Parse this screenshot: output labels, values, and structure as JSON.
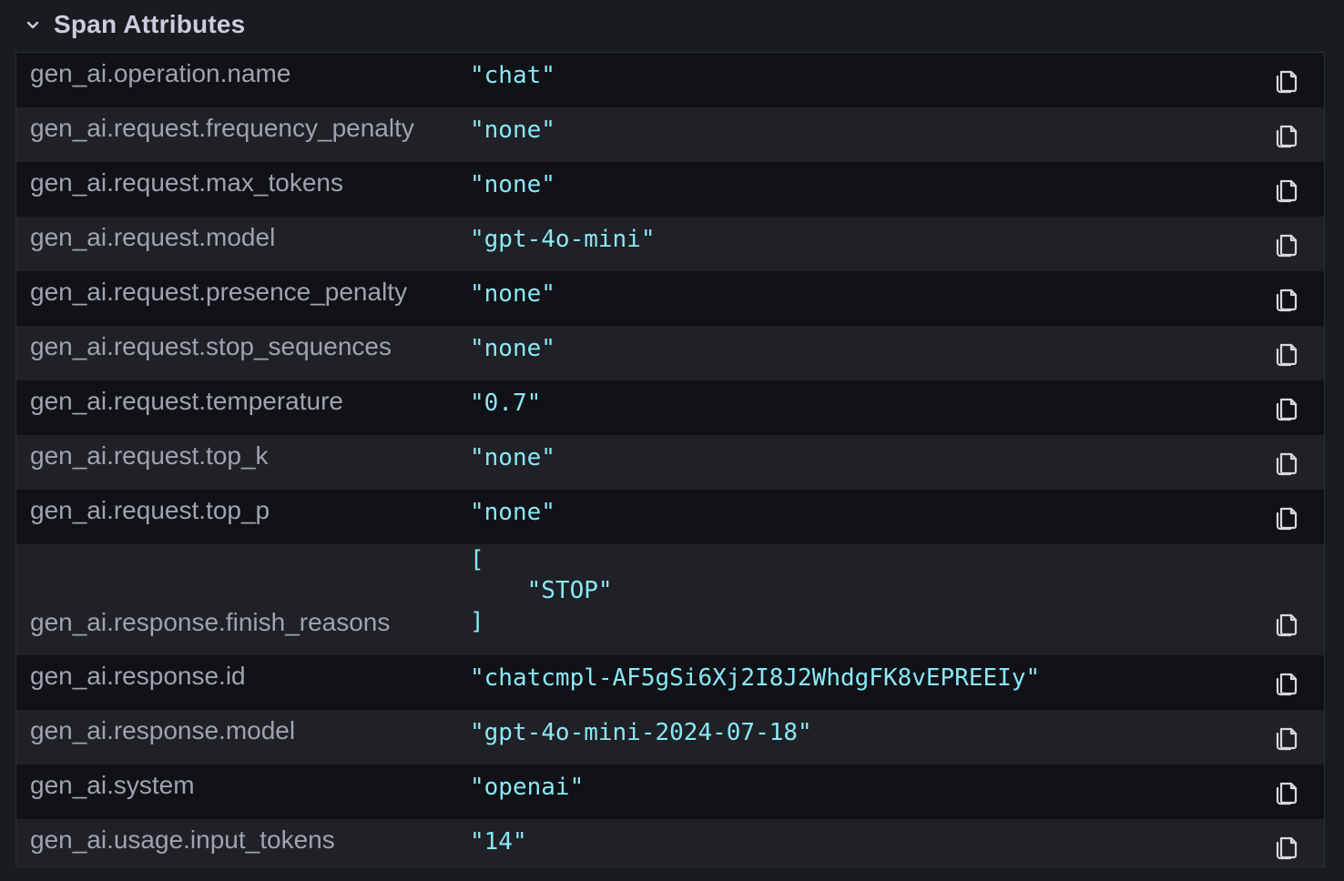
{
  "section": {
    "title": "Span Attributes"
  },
  "rows": [
    {
      "key": "gen_ai.operation.name",
      "value": "\"chat\""
    },
    {
      "key": "gen_ai.request.frequency_penalty",
      "value": "\"none\""
    },
    {
      "key": "gen_ai.request.max_tokens",
      "value": "\"none\""
    },
    {
      "key": "gen_ai.request.model",
      "value": "\"gpt-4o-mini\""
    },
    {
      "key": "gen_ai.request.presence_penalty",
      "value": "\"none\""
    },
    {
      "key": "gen_ai.request.stop_sequences",
      "value": "\"none\""
    },
    {
      "key": "gen_ai.request.temperature",
      "value": "\"0.7\""
    },
    {
      "key": "gen_ai.request.top_k",
      "value": "\"none\""
    },
    {
      "key": "gen_ai.request.top_p",
      "value": "\"none\""
    },
    {
      "key": "gen_ai.response.finish_reasons",
      "value": "[\n    \"STOP\"\n]"
    },
    {
      "key": "gen_ai.response.id",
      "value": "\"chatcmpl-AF5gSi6Xj2I8J2WhdgFK8vEPREEIy\""
    },
    {
      "key": "gen_ai.response.model",
      "value": "\"gpt-4o-mini-2024-07-18\""
    },
    {
      "key": "gen_ai.system",
      "value": "\"openai\""
    },
    {
      "key": "gen_ai.usage.input_tokens",
      "value": "\"14\""
    }
  ],
  "colors": {
    "key_text": "#9fa3ad",
    "value_text": "#8ae8f5",
    "row_dark": "#111217",
    "row_light": "#1f2127"
  },
  "icons": {
    "collapse": "chevron-down-icon",
    "copy": "copy-icon"
  }
}
